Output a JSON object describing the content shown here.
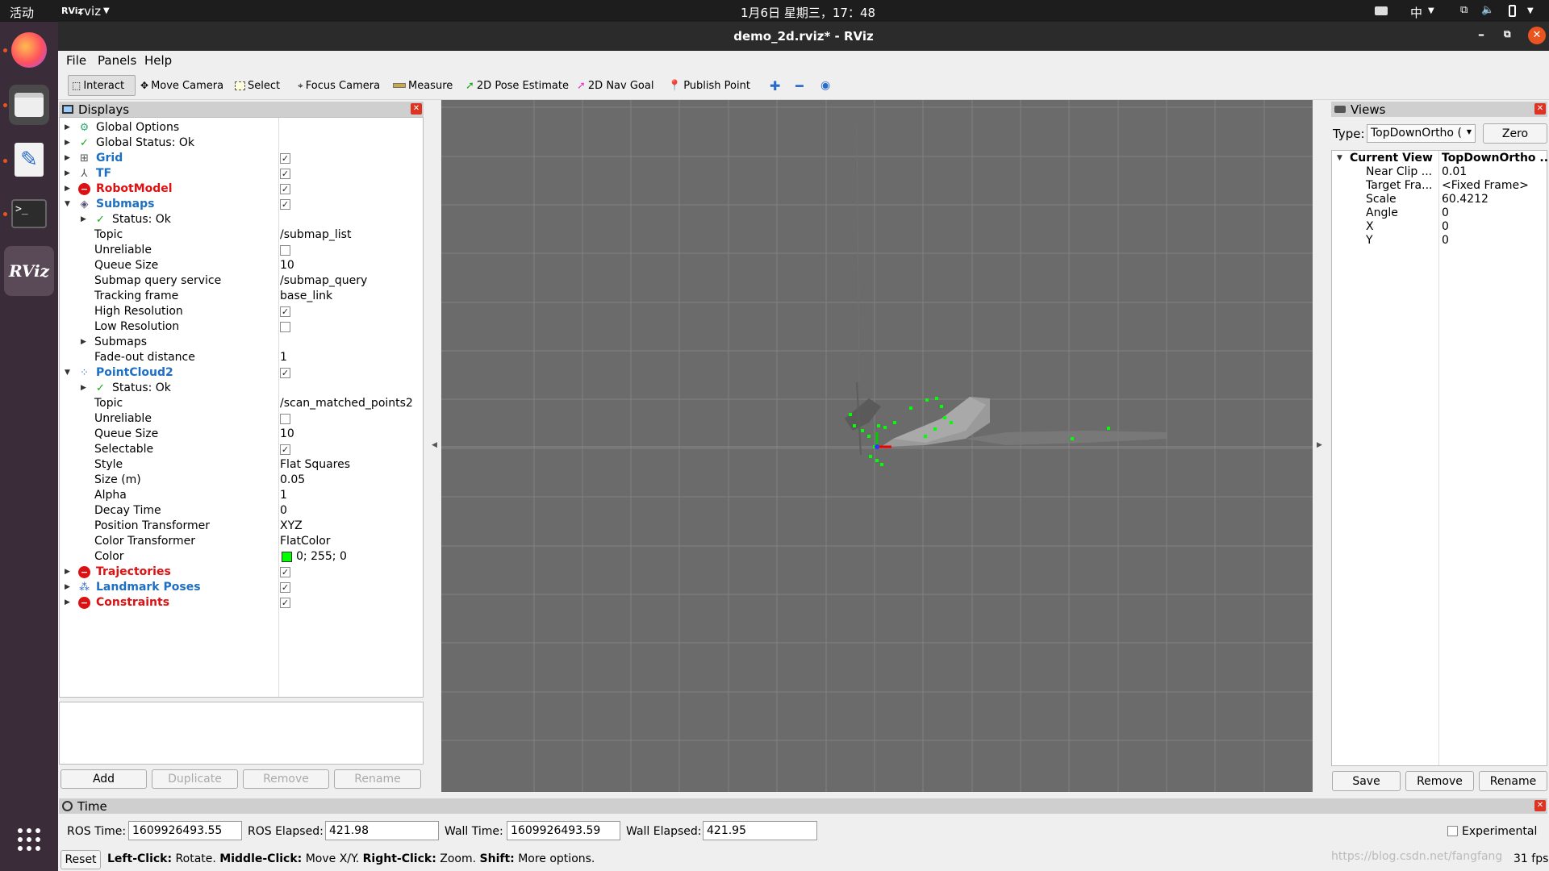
{
  "topbar": {
    "activities": "活动",
    "app_menu": "rviz",
    "clock": "1月6日 星期三，17：48",
    "ime": "中"
  },
  "dock": {
    "apps": [
      "firefox-icon",
      "files-icon",
      "text-editor-icon",
      "terminal-icon",
      "rviz-icon"
    ],
    "show_apps": "apps-grid-icon"
  },
  "window": {
    "title": "demo_2d.rviz* - RViz"
  },
  "menu": {
    "file": "File",
    "panels": "Panels",
    "help": "Help"
  },
  "toolbar": {
    "interact": "Interact",
    "move_camera": "Move Camera",
    "select": "Select",
    "focus_camera": "Focus Camera",
    "measure": "Measure",
    "pose_estimate": "2D Pose Estimate",
    "nav_goal": "2D Nav Goal",
    "publish_point": "Publish Point"
  },
  "displays": {
    "title": "Displays",
    "rows": [
      {
        "label": "Global Options"
      },
      {
        "label": "Global Status: Ok"
      },
      {
        "label": "Grid"
      },
      {
        "label": "TF"
      },
      {
        "label": "RobotModel"
      },
      {
        "label": "Submaps"
      },
      {
        "label": "Status: Ok"
      },
      {
        "label": "Topic",
        "value": "/submap_list"
      },
      {
        "label": "Unreliable"
      },
      {
        "label": "Queue Size",
        "value": "10"
      },
      {
        "label": "Submap query service",
        "value": "/submap_query"
      },
      {
        "label": "Tracking frame",
        "value": "base_link"
      },
      {
        "label": "High Resolution"
      },
      {
        "label": "Low Resolution"
      },
      {
        "label": "Submaps"
      },
      {
        "label": "Fade-out distance",
        "value": "1"
      },
      {
        "label": "PointCloud2"
      },
      {
        "label": "Status: Ok"
      },
      {
        "label": "Topic",
        "value": "/scan_matched_points2"
      },
      {
        "label": "Unreliable"
      },
      {
        "label": "Queue Size",
        "value": "10"
      },
      {
        "label": "Selectable"
      },
      {
        "label": "Style",
        "value": "Flat Squares"
      },
      {
        "label": "Size (m)",
        "value": "0.05"
      },
      {
        "label": "Alpha",
        "value": "1"
      },
      {
        "label": "Decay Time",
        "value": "0"
      },
      {
        "label": "Position Transformer",
        "value": "XYZ"
      },
      {
        "label": "Color Transformer",
        "value": "FlatColor"
      },
      {
        "label": "Color",
        "value": "0; 255; 0"
      },
      {
        "label": "Trajectories"
      },
      {
        "label": "Landmark Poses"
      },
      {
        "label": "Constraints"
      }
    ],
    "buttons": {
      "add": "Add",
      "duplicate": "Duplicate",
      "remove": "Remove",
      "rename": "Rename"
    }
  },
  "views": {
    "title": "Views",
    "type_label": "Type:",
    "type_value": "TopDownOrtho (",
    "zero": "Zero",
    "current_view": "Current View",
    "current_view_value": "TopDownOrtho ...",
    "props": [
      {
        "label": "Near Clip ...",
        "value": "0.01"
      },
      {
        "label": "Target Fra...",
        "value": "<Fixed Frame>"
      },
      {
        "label": "Scale",
        "value": "60.4212"
      },
      {
        "label": "Angle",
        "value": "0"
      },
      {
        "label": "X",
        "value": "0"
      },
      {
        "label": "Y",
        "value": "0"
      }
    ],
    "buttons": {
      "save": "Save",
      "remove": "Remove",
      "rename": "Rename"
    }
  },
  "time": {
    "title": "Time",
    "ros_time_label": "ROS Time:",
    "ros_time": "1609926493.55",
    "ros_elapsed_label": "ROS Elapsed:",
    "ros_elapsed": "421.98",
    "wall_time_label": "Wall Time:",
    "wall_time": "1609926493.59",
    "wall_elapsed_label": "Wall Elapsed:",
    "wall_elapsed": "421.95",
    "experimental": "Experimental"
  },
  "status": {
    "reset": "Reset",
    "left_click": "Left-Click:",
    "left_desc": "Rotate.",
    "middle_click": "Middle-Click:",
    "middle_desc": "Move X/Y.",
    "right_click": "Right-Click:",
    "right_desc": "Zoom.",
    "shift": "Shift:",
    "shift_desc": "More options.",
    "watermark": "https://blog.csdn.net/fangfang",
    "fps": "31 fps"
  },
  "colors": {
    "pointcloud": "#00ff00",
    "viewport_bg": "#6b6b6b",
    "grid": "#808080"
  }
}
